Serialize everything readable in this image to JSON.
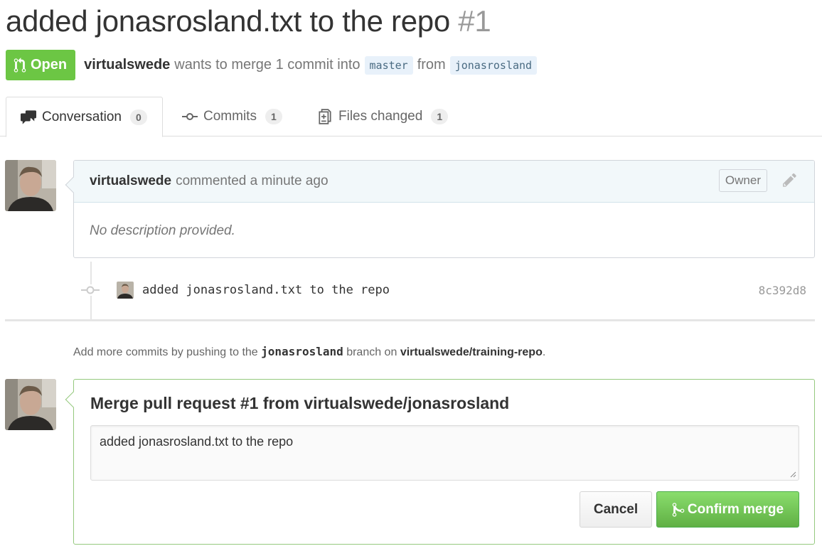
{
  "pull_request": {
    "title": "added jonasrosland.txt to the repo",
    "number": "#1",
    "state": "Open",
    "author": "virtualswede",
    "summary_text": "wants to merge 1 commit into",
    "base_branch": "master",
    "from_text": "from",
    "head_branch": "jonasrosland"
  },
  "tabs": [
    {
      "label": "Conversation",
      "count": "0",
      "icon": "comment-discussion-icon",
      "selected": true
    },
    {
      "label": "Commits",
      "count": "1",
      "icon": "git-commit-icon",
      "selected": false
    },
    {
      "label": "Files changed",
      "count": "1",
      "icon": "file-diff-icon",
      "selected": false
    }
  ],
  "comment": {
    "author": "virtualswede",
    "action_text": "commented a minute ago",
    "badge": "Owner",
    "body": "No description provided."
  },
  "commit": {
    "message": "added jonasrosland.txt to the repo",
    "sha": "8c392d8"
  },
  "push_hint": {
    "prefix": "Add more commits by pushing to the",
    "branch": "jonasrosland",
    "middle": "branch on",
    "repo": "virtualswede/training-repo",
    "suffix": "."
  },
  "merge": {
    "title": "Merge pull request #1 from virtualswede/jonasrosland",
    "message": "added jonasrosland.txt to the repo",
    "cancel_label": "Cancel",
    "confirm_label": "Confirm merge"
  },
  "colors": {
    "open_green": "#6cc644",
    "confirm_green": "#60b044",
    "merge_border": "#95c97e",
    "comment_header_bg": "#f2f8fa",
    "branch_bg": "#e8f1fa"
  }
}
